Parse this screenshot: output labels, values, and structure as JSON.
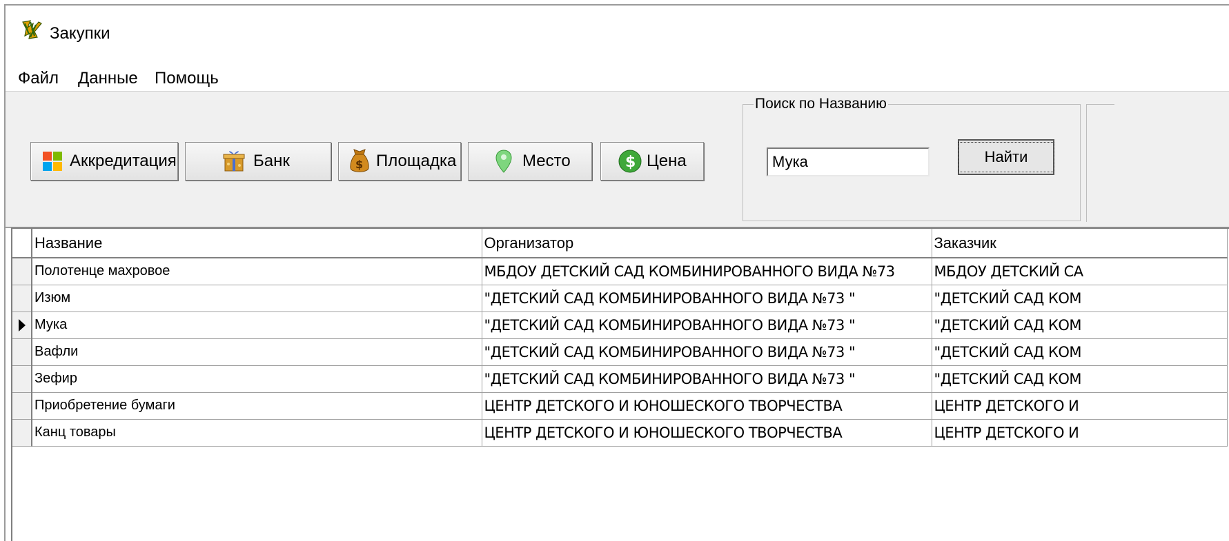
{
  "window": {
    "title": "Закупки"
  },
  "menu": [
    "Файл",
    "Данные",
    "Помощь"
  ],
  "toolbar": {
    "buttons": [
      {
        "label": "Аккредитация",
        "icon": "windows-logo-icon"
      },
      {
        "label": "Банк",
        "icon": "bank-gift-icon"
      },
      {
        "label": "Площадка",
        "icon": "money-bag-icon"
      },
      {
        "label": "Место",
        "icon": "location-pin-icon"
      },
      {
        "label": "Цена",
        "icon": "dollar-coin-icon"
      }
    ]
  },
  "search": {
    "group_label": "Поиск по Названию",
    "value": "Мука",
    "button_label": "Найти"
  },
  "grid": {
    "columns": [
      "Название",
      "Организатор",
      "Заказчик"
    ],
    "rows": [
      [
        "Полотенце махровое",
        "МБДОУ ДЕТСКИЙ САД КОМБИНИРОВАННОГО ВИДА №73",
        "МБДОУ ДЕТСКИЙ СА"
      ],
      [
        "Изюм",
        "\"ДЕТСКИЙ САД КОМБИНИРОВАННОГО ВИДА №73 \"",
        "\"ДЕТСКИЙ САД КОМ"
      ],
      [
        "Мука",
        "\"ДЕТСКИЙ САД КОМБИНИРОВАННОГО ВИДА №73 \"",
        "\"ДЕТСКИЙ САД КОМ"
      ],
      [
        "Вафли",
        "\"ДЕТСКИЙ САД КОМБИНИРОВАННОГО ВИДА №73 \"",
        "\"ДЕТСКИЙ САД КОМ"
      ],
      [
        "Зефир",
        "\"ДЕТСКИЙ САД КОМБИНИРОВАННОГО ВИДА №73 \"",
        "\"ДЕТСКИЙ САД КОМ"
      ],
      [
        "Приобретение бумаги",
        "ЦЕНТР ДЕТСКОГО И ЮНОШЕСКОГО ТВОРЧЕСТВА",
        "ЦЕНТР ДЕТСКОГО И"
      ],
      [
        "Канц товары",
        "ЦЕНТР ДЕТСКОГО И ЮНОШЕСКОГО ТВОРЧЕСТВА",
        "ЦЕНТР ДЕТСКОГО И"
      ]
    ],
    "current_row": 2
  }
}
